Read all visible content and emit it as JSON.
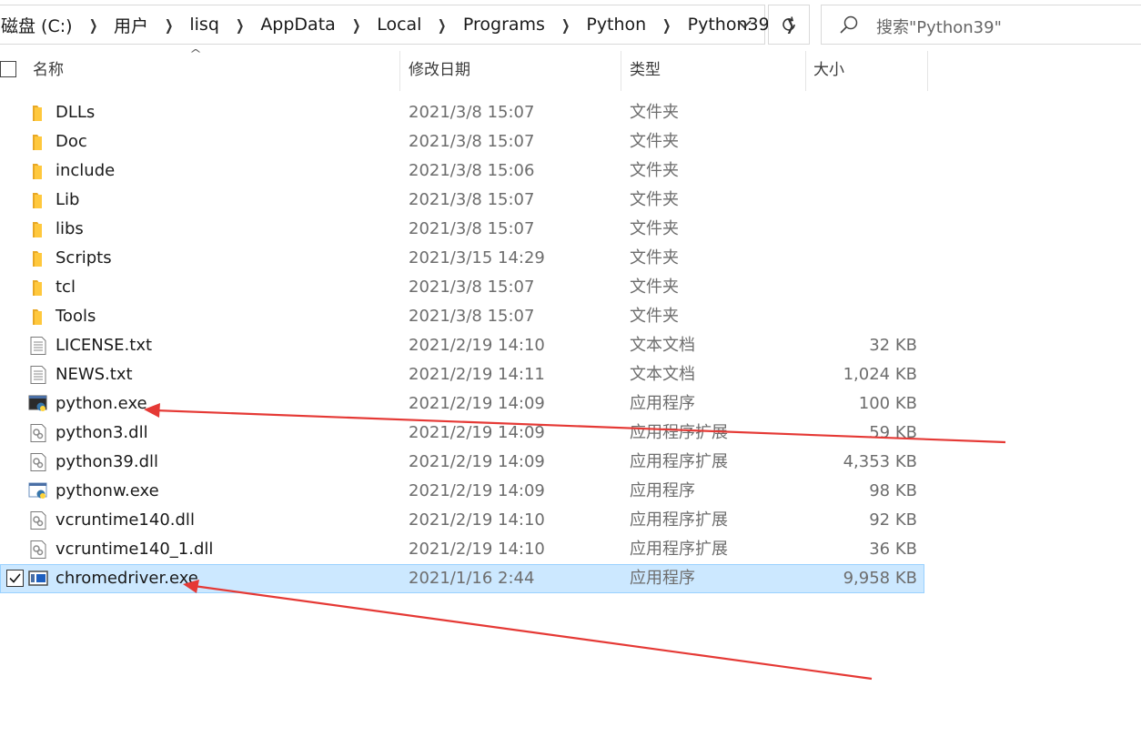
{
  "address_bar": {
    "crumbs": [
      "磁盘 (C:)",
      "用户",
      "lisq",
      "AppData",
      "Local",
      "Programs",
      "Python",
      "Python39"
    ]
  },
  "search": {
    "placeholder": "搜索\"Python39\""
  },
  "columns": {
    "name": "名称",
    "date": "修改日期",
    "type": "类型",
    "size": "大小"
  },
  "files": [
    {
      "name": "DLLs",
      "date": "2021/3/8 15:07",
      "type": "文件夹",
      "size": "",
      "icon": "folder-icon"
    },
    {
      "name": "Doc",
      "date": "2021/3/8 15:07",
      "type": "文件夹",
      "size": "",
      "icon": "folder-icon"
    },
    {
      "name": "include",
      "date": "2021/3/8 15:06",
      "type": "文件夹",
      "size": "",
      "icon": "folder-icon"
    },
    {
      "name": "Lib",
      "date": "2021/3/8 15:07",
      "type": "文件夹",
      "size": "",
      "icon": "folder-icon"
    },
    {
      "name": "libs",
      "date": "2021/3/8 15:07",
      "type": "文件夹",
      "size": "",
      "icon": "folder-icon"
    },
    {
      "name": "Scripts",
      "date": "2021/3/15 14:29",
      "type": "文件夹",
      "size": "",
      "icon": "folder-icon"
    },
    {
      "name": "tcl",
      "date": "2021/3/8 15:07",
      "type": "文件夹",
      "size": "",
      "icon": "folder-icon"
    },
    {
      "name": "Tools",
      "date": "2021/3/8 15:07",
      "type": "文件夹",
      "size": "",
      "icon": "folder-icon"
    },
    {
      "name": "LICENSE.txt",
      "date": "2021/2/19 14:10",
      "type": "文本文档",
      "size": "32 KB",
      "icon": "text-file-icon"
    },
    {
      "name": "NEWS.txt",
      "date": "2021/2/19 14:11",
      "type": "文本文档",
      "size": "1,024 KB",
      "icon": "text-file-icon"
    },
    {
      "name": "python.exe",
      "date": "2021/2/19 14:09",
      "type": "应用程序",
      "size": "100 KB",
      "icon": "python-console-icon"
    },
    {
      "name": "python3.dll",
      "date": "2021/2/19 14:09",
      "type": "应用程序扩展",
      "size": "59 KB",
      "icon": "dll-file-icon"
    },
    {
      "name": "python39.dll",
      "date": "2021/2/19 14:09",
      "type": "应用程序扩展",
      "size": "4,353 KB",
      "icon": "dll-file-icon"
    },
    {
      "name": "pythonw.exe",
      "date": "2021/2/19 14:09",
      "type": "应用程序",
      "size": "98 KB",
      "icon": "python-window-icon"
    },
    {
      "name": "vcruntime140.dll",
      "date": "2021/2/19 14:10",
      "type": "应用程序扩展",
      "size": "92 KB",
      "icon": "dll-file-icon"
    },
    {
      "name": "vcruntime140_1.dll",
      "date": "2021/2/19 14:10",
      "type": "应用程序扩展",
      "size": "36 KB",
      "icon": "dll-file-icon"
    },
    {
      "name": "chromedriver.exe",
      "date": "2021/1/16 2:44",
      "type": "应用程序",
      "size": "9,958 KB",
      "icon": "application-icon",
      "selected": true
    }
  ],
  "colors": {
    "selection": "#cce8ff",
    "selection_border": "#99d1ff",
    "annotation_arrow": "#e53935",
    "folder": "#ffc83d"
  }
}
